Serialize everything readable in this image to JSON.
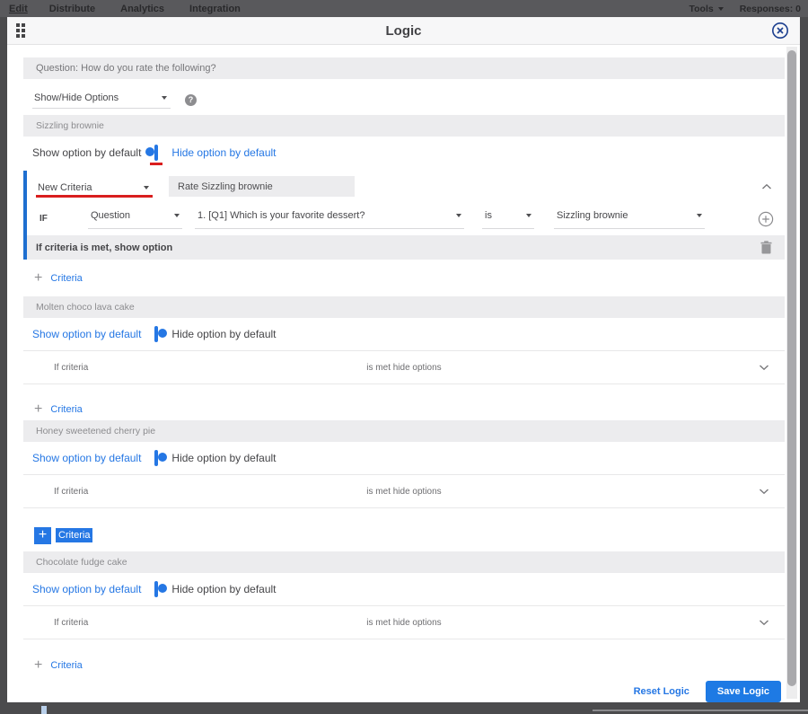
{
  "colors": {
    "accent_blue": "#2577e4",
    "criteria_border_blue": "#1e6fd0",
    "annotation_red": "#d91e1e",
    "save_button_bg": "#1e7ae4",
    "topbar_bg": "#59595c",
    "header_bg": "#f7f7f8",
    "row_gray_bg": "#ececee"
  },
  "topbar": {
    "tabs": [
      {
        "label": "Edit",
        "active": true
      },
      {
        "label": "Distribute",
        "active": false
      },
      {
        "label": "Analytics",
        "active": false
      },
      {
        "label": "Integration",
        "active": false
      }
    ],
    "tools_label": "Tools",
    "responses_label": "Responses: 0"
  },
  "dialog": {
    "title": "Logic",
    "question_label": "Question: How do you rate the following?",
    "logic_type_value": "Show/Hide Options"
  },
  "sections": [
    {
      "name": "Sizzling brownie",
      "show_label": "Show option by default",
      "hide_label": "Hide option by default",
      "toggle_on": true,
      "expanded": true,
      "editor": {
        "criteria_select": "New Criteria",
        "description": "Rate Sizzling brownie",
        "if_label": "IF",
        "type_select": "Question",
        "question_select": "1. [Q1] Which is your favorite dessert?",
        "operator_select": "is",
        "value_select": "Sizzling brownie",
        "result_label": "If criteria is met, show option"
      },
      "add_criteria_label": "Criteria"
    },
    {
      "name": "Molten choco lava cake",
      "show_label": "Show option by default",
      "hide_label": "Hide option by default",
      "toggle_on": false,
      "collapsed": {
        "left_label": "If criteria",
        "center_label": "is met hide options"
      },
      "add_criteria_label": "Criteria"
    },
    {
      "name": "Honey sweetened cherry pie",
      "show_label": "Show option by default",
      "hide_label": "Hide option by default",
      "toggle_on": false,
      "collapsed": {
        "left_label": "If criteria",
        "center_label": "is met hide options"
      },
      "add_criteria_label": "Criteria",
      "add_criteria_highlighted": true
    },
    {
      "name": "Chocolate fudge cake",
      "show_label": "Show option by default",
      "hide_label": "Hide option by default",
      "toggle_on": false,
      "collapsed": {
        "left_label": "If criteria",
        "center_label": "is met hide options"
      },
      "add_criteria_label": "Criteria"
    }
  ],
  "footer": {
    "reset_label": "Reset Logic",
    "save_label": "Save Logic"
  },
  "icons": {
    "drag_handle": "six-dot-grid",
    "help": "question-mark-circle",
    "close": "x-in-circle",
    "caret": "triangle-down",
    "chevron_up": "chevron-up",
    "chevron_down": "chevron-down",
    "add_circle": "plus-in-circle",
    "plus": "plus",
    "trash": "trash-can",
    "help_glyph": "?"
  }
}
